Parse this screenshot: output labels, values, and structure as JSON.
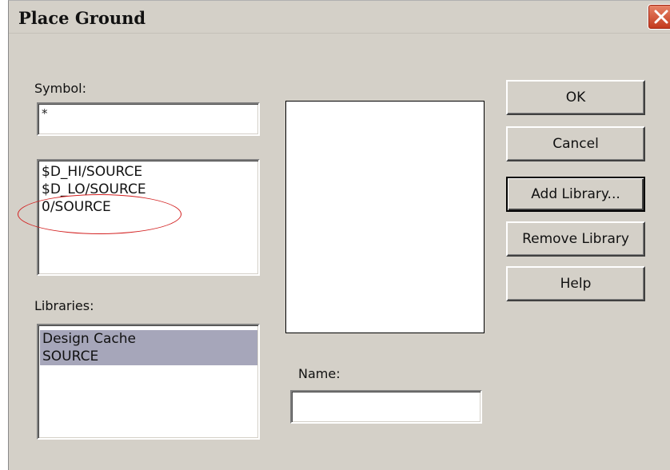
{
  "window": {
    "title": "Place Ground"
  },
  "symbol": {
    "label": "Symbol:",
    "value": "*"
  },
  "symbols_list": {
    "items": [
      "$D_HI/SOURCE",
      "$D_LO/SOURCE",
      "0/SOURCE"
    ]
  },
  "libraries": {
    "label": "Libraries:",
    "items": [
      "Design Cache",
      "SOURCE"
    ]
  },
  "name": {
    "label": "Name:",
    "value": ""
  },
  "buttons": {
    "ok": "OK",
    "cancel": "Cancel",
    "add_library": "Add Library...",
    "remove_library": "Remove Library",
    "help": "Help"
  },
  "colors": {
    "selection": "#a6a6ba",
    "dialog_bg": "#d4d0c8",
    "annotation": "#d32222"
  }
}
